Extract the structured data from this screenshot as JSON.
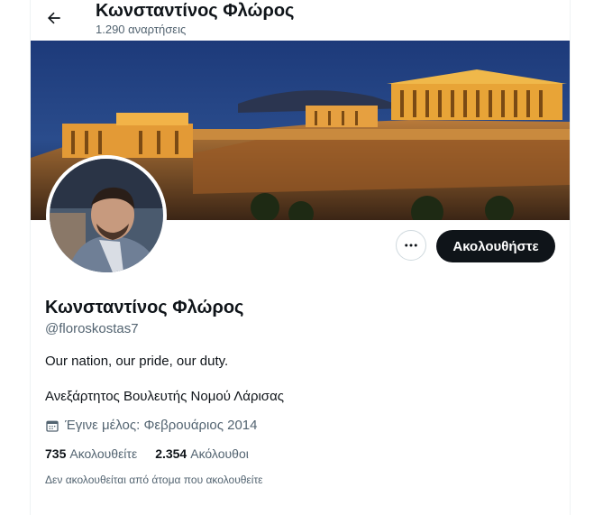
{
  "header": {
    "title": "Κωνσταντίνος Φλώρος",
    "posts_count": "1.290 αναρτήσεις"
  },
  "icons": {
    "back": "arrow-left-icon",
    "more": "more-dots-icon",
    "calendar": "calendar-icon"
  },
  "actions": {
    "follow_label": "Ακολουθήστε"
  },
  "profile": {
    "name": "Κωνσταντίνος Φλώρος",
    "handle": "@floroskostas7",
    "bio": "Our nation, our pride, our duty.",
    "description": "Ανεξάρτητος Βουλευτής Νομού Λάρισας",
    "joined": "Έγινε μέλος: Φεβρουάριος 2014",
    "following_count": "735",
    "following_label": "Ακολουθείτε",
    "followers_count": "2.354",
    "followers_label": "Ακόλουθοι",
    "followed_by_note": "Δεν ακολουθείται από άτομα που ακολουθείτε"
  },
  "colors": {
    "text_primary": "#0f1419",
    "text_secondary": "#536471",
    "button_dark": "#0f1419",
    "border": "#cfd9de"
  }
}
